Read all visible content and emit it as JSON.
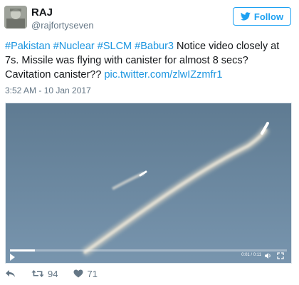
{
  "author": {
    "name": "RAJ",
    "handle": "@rajfortyseven"
  },
  "follow_button": {
    "label": "Follow",
    "icon": "twitter-bird-icon"
  },
  "tweet": {
    "hashtags": "#Pakistan #Nuclear #SLCM #Babur3",
    "text": "Notice video closely at 7s. Missile was flying with canister for almost 8 secs? Cavitation canister??",
    "link": "pic.twitter.com/zlwIZzmfr1",
    "timestamp": "3:52 AM - 10 Jan 2017"
  },
  "video": {
    "time_readout": "0:01 / 0:11",
    "progress_fraction": 0.09,
    "play_icon": "play-icon",
    "volume_icon": "volume-icon",
    "fullscreen_icon": "fullscreen-icon"
  },
  "actions": {
    "reply_icon": "reply-icon",
    "retweet_icon": "retweet-icon",
    "retweets": "94",
    "like_icon": "heart-icon",
    "likes": "71"
  },
  "colors": {
    "accent": "#1da1f2",
    "link": "#1b95e0",
    "muted": "#657786"
  }
}
